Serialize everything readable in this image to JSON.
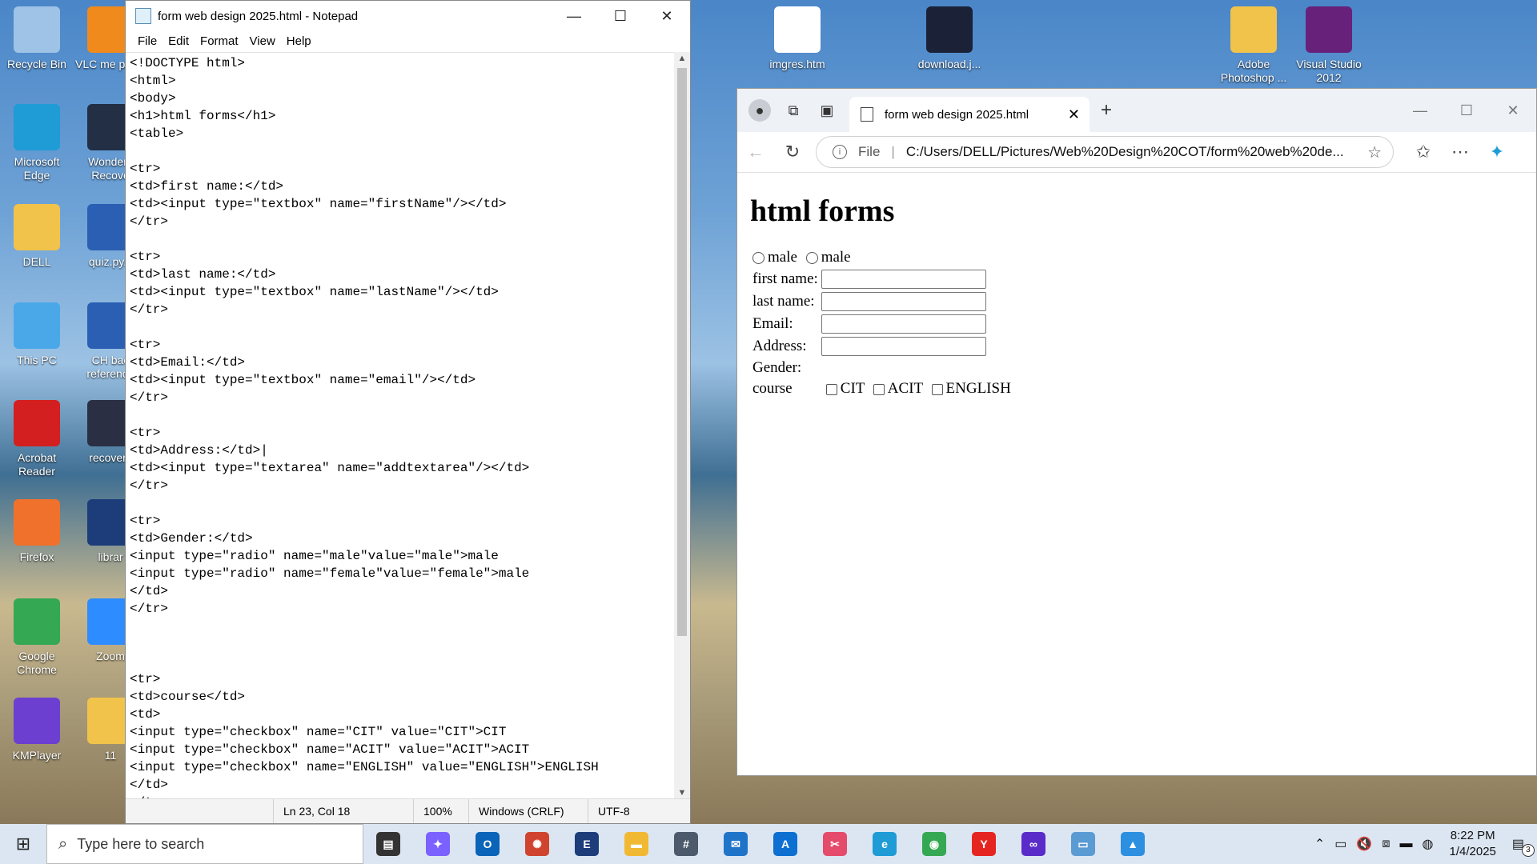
{
  "desktop": {
    "icons_left": [
      {
        "label": "Recycle Bin",
        "icon": "recycle-bin-icon",
        "color": "#9ec3e6"
      },
      {
        "label": "Microsoft Edge",
        "icon": "edge-icon",
        "color": "#1f9bd6"
      },
      {
        "label": "DELL",
        "icon": "folder-user-icon",
        "color": "#f1c34a"
      },
      {
        "label": "This PC",
        "icon": "pc-icon",
        "color": "#4aa8e8"
      },
      {
        "label": "Acrobat Reader",
        "icon": "acrobat-icon",
        "color": "#d31f1f"
      },
      {
        "label": "Firefox",
        "icon": "firefox-icon",
        "color": "#f0712c"
      },
      {
        "label": "Google Chrome",
        "icon": "chrome-icon",
        "color": "#34a853"
      },
      {
        "label": "KMPlayer",
        "icon": "kmplayer-icon",
        "color": "#6c3fd1"
      }
    ],
    "icons_col2": [
      {
        "label": "VLC me playe",
        "icon": "vlc-icon",
        "color": "#f08a1c"
      },
      {
        "label": "Wonders Recove",
        "icon": "wondershare-icon",
        "color": "#222f44"
      },
      {
        "label": "quiz.py.c",
        "icon": "word-doc-icon",
        "color": "#2b5fb4"
      },
      {
        "label": "CH bac reference",
        "icon": "word-doc-icon",
        "color": "#2b5fb4"
      },
      {
        "label": "recoverit",
        "icon": "recoverit-icon",
        "color": "#2b2f44"
      },
      {
        "label": "librar",
        "icon": "ecu-library-icon",
        "color": "#1c3d7a"
      },
      {
        "label": "Zoom",
        "icon": "zoom-icon",
        "color": "#2d8cff"
      },
      {
        "label": "11",
        "icon": "folder-icon",
        "color": "#f1c34a"
      }
    ],
    "icons_top": [
      {
        "label": "imgres.htm",
        "icon": "html-file-icon",
        "color": "#ffffff"
      },
      {
        "label": "download.j...",
        "icon": "image-file-icon",
        "color": "#1b2238"
      },
      {
        "label": "Adobe Photoshop ...",
        "icon": "folder-icon",
        "color": "#f1c34a"
      },
      {
        "label": "Visual Studio 2012",
        "icon": "visual-studio-icon",
        "color": "#68217a"
      }
    ]
  },
  "notepad": {
    "title": "form web design 2025.html - Notepad",
    "menu": [
      "File",
      "Edit",
      "Format",
      "View",
      "Help"
    ],
    "code": "<!DOCTYPE html>\n<html>\n<body>\n<h1>html forms</h1>\n<table>\n\n<tr>\n<td>first name:</td>\n<td><input type=\"textbox\" name=\"firstName\"/></td>\n</tr>\n\n<tr>\n<td>last name:</td>\n<td><input type=\"textbox\" name=\"lastName\"/></td>\n</tr>\n\n<tr>\n<td>Email:</td>\n<td><input type=\"textbox\" name=\"email\"/></td>\n</tr>\n\n<tr>\n<td>Address:</td>|\n<td><input type=\"textarea\" name=\"addtextarea\"/></td>\n</tr>\n\n<tr>\n<td>Gender:</td>\n<input type=\"radio\" name=\"male\"value=\"male\">male\n<input type=\"radio\" name=\"female\"value=\"female\">male\n</td>\n</tr>\n\n\n\n<tr>\n<td>course</td>\n<td>\n<input type=\"checkbox\" name=\"CIT\" value=\"CIT\">CIT\n<input type=\"checkbox\" name=\"ACIT\" value=\"ACIT\">ACIT\n<input type=\"checkbox\" name=\"ENGLISH\" value=\"ENGLISH\">ENGLISH\n</td>\n</tr>",
    "status": {
      "position": "Ln 23, Col 18",
      "zoom": "100%",
      "line_ending": "Windows (CRLF)",
      "encoding": "UTF-8"
    }
  },
  "browser": {
    "tab_title": "form web design 2025.html",
    "url_scheme": "File",
    "url": "C:/Users/DELL/Pictures/Web%20Design%20COT/form%20web%20de...",
    "page": {
      "heading": "html forms",
      "radio_labels": [
        "male",
        "male"
      ],
      "rows": [
        "first name:",
        "last name:",
        "Email:",
        "Address:"
      ],
      "gender_label": "Gender:",
      "course_label": "course",
      "checkboxes": [
        "CIT",
        "ACIT",
        "ENGLISH"
      ]
    }
  },
  "taskbar": {
    "search_placeholder": "Type here to search",
    "apps": [
      {
        "name": "task-view-icon",
        "color": "#333333",
        "glyph": "▤"
      },
      {
        "name": "copilot-icon",
        "color": "#7b61ff",
        "glyph": "✦"
      },
      {
        "name": "outlook-icon",
        "color": "#0a64b8",
        "glyph": "O"
      },
      {
        "name": "settings-app-icon",
        "color": "#d0442f",
        "glyph": "✺"
      },
      {
        "name": "ecu-website-icon",
        "color": "#1c3d7a",
        "glyph": "E"
      },
      {
        "name": "file-explorer-icon",
        "color": "#f1b933",
        "glyph": "▬"
      },
      {
        "name": "calculator-icon",
        "color": "#4d5a6b",
        "glyph": "#"
      },
      {
        "name": "mail-icon",
        "color": "#1f74c9",
        "glyph": "✉"
      },
      {
        "name": "azure-icon",
        "color": "#0c6fd1",
        "glyph": "A"
      },
      {
        "name": "snipping-tool-icon",
        "color": "#e54b6b",
        "glyph": "✂"
      },
      {
        "name": "edge-taskbar-icon",
        "color": "#1f9bd6",
        "glyph": "e"
      },
      {
        "name": "chrome-taskbar-icon",
        "color": "#34a853",
        "glyph": "◉"
      },
      {
        "name": "yandex-icon",
        "color": "#e52620",
        "glyph": "Y"
      },
      {
        "name": "vpn-icon",
        "color": "#5b2bc9",
        "glyph": "∞"
      },
      {
        "name": "notepad-taskbar-icon",
        "color": "#5a9bd3",
        "glyph": "▭"
      },
      {
        "name": "paint-icon",
        "color": "#2c8fe0",
        "glyph": "▲"
      }
    ],
    "time": "8:22 PM",
    "date": "1/4/2025",
    "notification_count": "3"
  }
}
